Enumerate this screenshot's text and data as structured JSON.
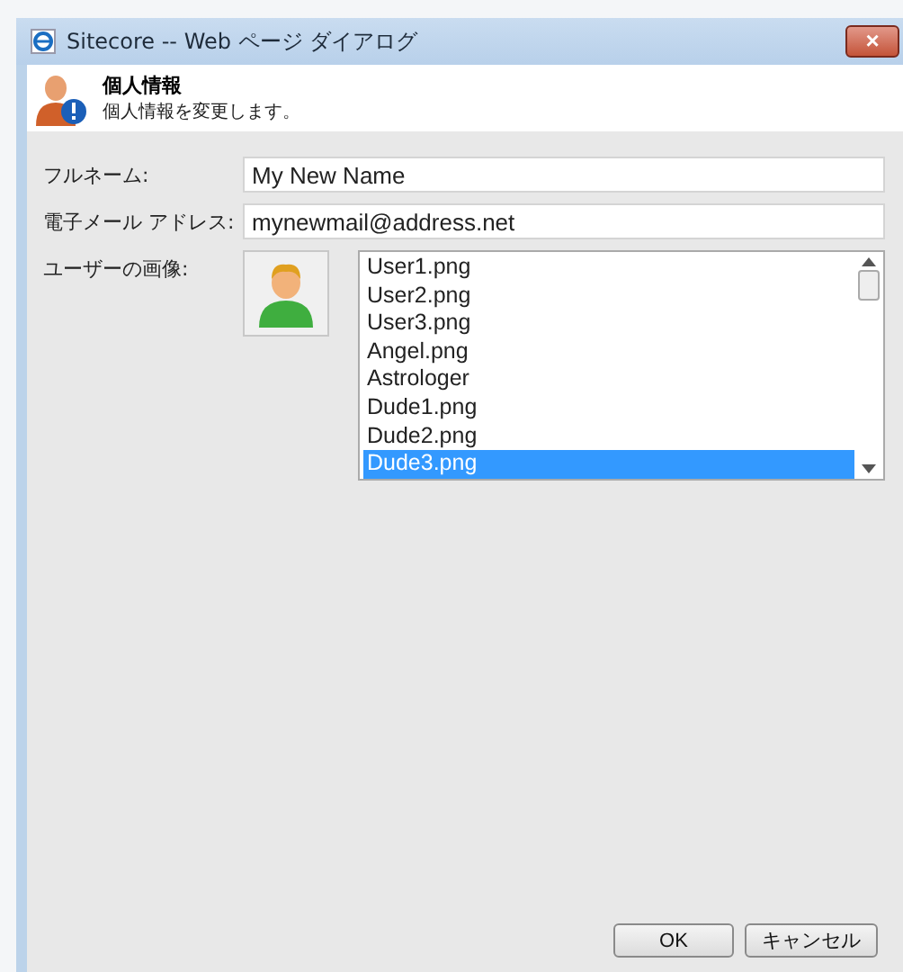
{
  "window": {
    "title": "Sitecore -- Web ページ ダイアログ",
    "close": "×"
  },
  "header": {
    "title": "個人情報",
    "subtitle": "個人情報を変更します。"
  },
  "fields": [
    {
      "label": "フルネーム:",
      "value": "My New Name"
    },
    {
      "label": "電子メール アドレス:",
      "value": "mynewmail@address.net"
    }
  ],
  "picture": {
    "label": "ユーザーの画像:",
    "items": [
      {
        "label": "User1.png",
        "selected": false
      },
      {
        "label": "User2.png",
        "selected": false
      },
      {
        "label": "User3.png",
        "selected": false
      },
      {
        "label": "Angel.png",
        "selected": false
      },
      {
        "label": "Astrologer",
        "selected": false
      },
      {
        "label": "Dude1.png",
        "selected": false
      },
      {
        "label": "Dude2.png",
        "selected": false
      },
      {
        "label": "Dude3.png",
        "selected": true
      }
    ]
  },
  "buttons": [
    "OK",
    "キャンセル"
  ]
}
